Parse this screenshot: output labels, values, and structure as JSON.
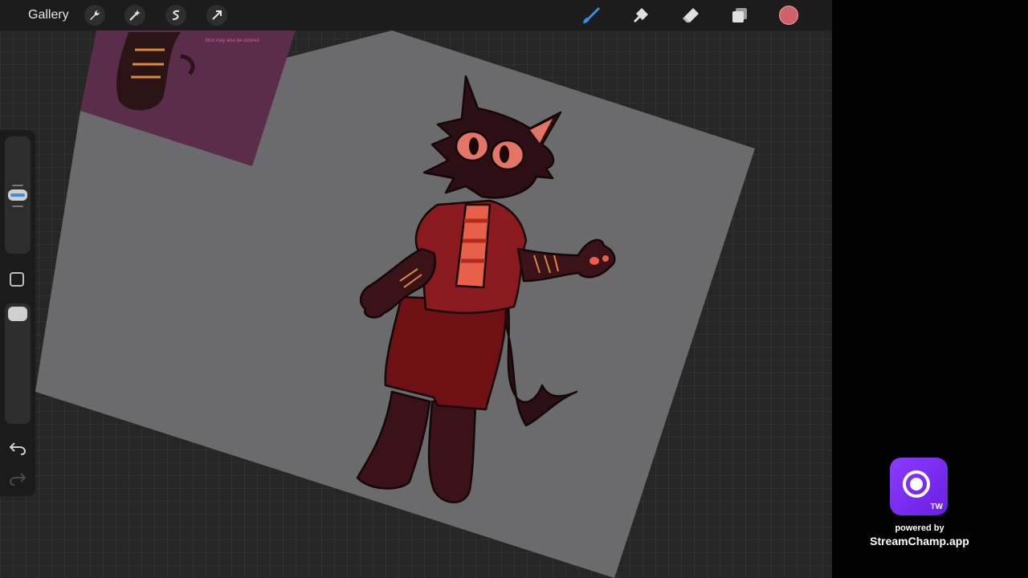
{
  "app": {
    "gallery_label": "Gallery",
    "left_tools": [
      "wrench-icon",
      "magic-wand-icon",
      "selection-icon",
      "transform-arrow-icon"
    ],
    "right_tools": [
      "brush-icon",
      "smudge-icon",
      "eraser-icon",
      "layers-icon"
    ],
    "active_tool": "brush-icon",
    "current_color": "#d06168",
    "accent_color": "#3a8fe8"
  },
  "sidebar": {
    "brush_size_level": 0.45,
    "opacity_level": 1.0,
    "buttons": [
      "modify-button",
      "undo-icon",
      "redo-icon"
    ]
  },
  "canvas": {
    "reference_text": "Shirt may also be colored",
    "background_color": "#2a2a2a"
  },
  "overlay": {
    "icon_badge": "TW",
    "powered_by": "powered by",
    "brand": "StreamChamp.app",
    "icon_color": "#7a2cf2"
  }
}
